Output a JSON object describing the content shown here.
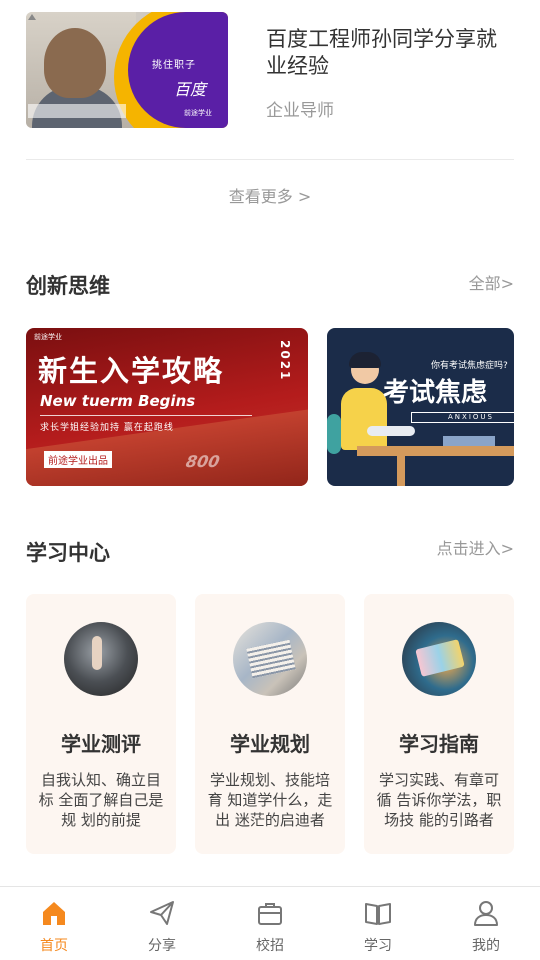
{
  "featured_video": {
    "title": "百度工程师孙同学分享就业经验",
    "subtitle": "企业导师",
    "thumb_text_1": "挑住职子",
    "thumb_text_2": "百度",
    "thumb_logo": "前途学业"
  },
  "see_more": "查看更多 >",
  "innovation": {
    "title": "创新思维",
    "link": "全部>",
    "banners": [
      {
        "logo": "前途学业",
        "title": "新生入学攻略",
        "year": "2021",
        "english": "New tuerm Begins",
        "slogan": "求长学姐经验加持 赢在起跑线",
        "badge": "前途学业出品",
        "track_number": "800"
      },
      {
        "question": "你有考试焦虑症吗?",
        "title": "考试焦虑",
        "english": "ANXIOUS"
      }
    ]
  },
  "learning_center": {
    "title": "学习中心",
    "link": "点击进入>",
    "cards": [
      {
        "title": "学业测评",
        "desc": "自我认知、确立目标 全面了解自己是规 划的前提",
        "icon": "touch-screen-photo"
      },
      {
        "title": "学业规划",
        "desc": "学业规划、技能培育 知道学什么，走出 迷茫的启迪者",
        "icon": "books-photo"
      },
      {
        "title": "学习指南",
        "desc": "学习实践、有章可循 告诉你学法，职场技 能的引路者",
        "icon": "tablet-photo"
      }
    ]
  },
  "tabbar": {
    "active_color": "#f5891e",
    "items": [
      {
        "label": "首页",
        "icon": "home-icon",
        "active": true
      },
      {
        "label": "分享",
        "icon": "paper-plane-icon",
        "active": false
      },
      {
        "label": "校招",
        "icon": "briefcase-icon",
        "active": false
      },
      {
        "label": "学习",
        "icon": "book-icon",
        "active": false
      },
      {
        "label": "我的",
        "icon": "user-icon",
        "active": false
      }
    ]
  }
}
